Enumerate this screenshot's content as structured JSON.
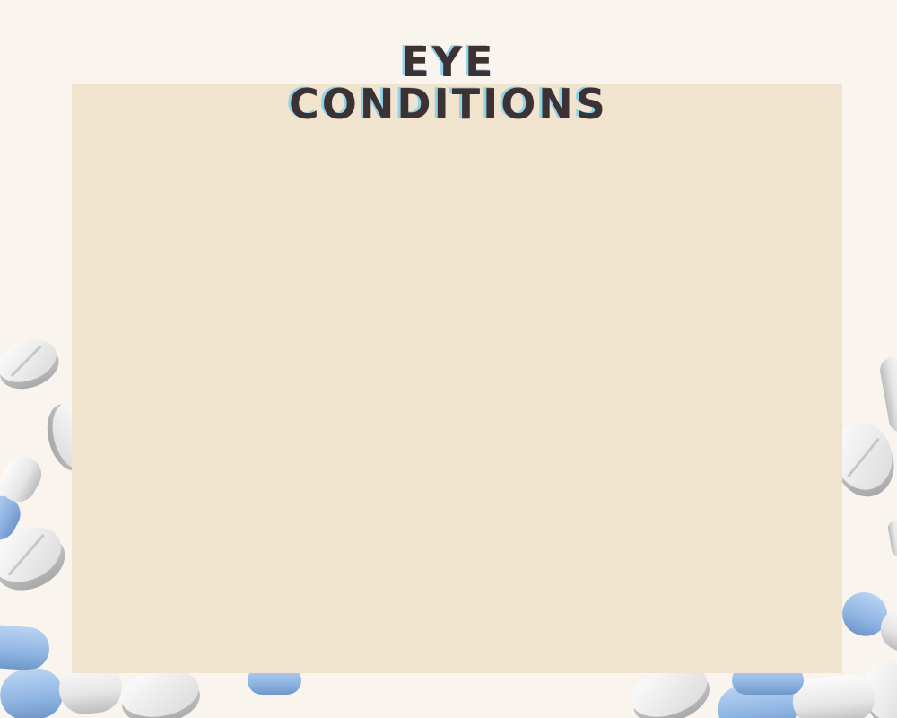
{
  "title": {
    "line1": "EYE",
    "line2": "CONDITIONS"
  },
  "decor": {
    "background_color": "#f9f5ee",
    "panel_color": "#f0e4cf",
    "title_color": "#3c3133",
    "title_shadow_color": "#8fd3ea",
    "pill_white": "#eeeeee",
    "pill_blue": "#8fb5e3",
    "icons": [
      "tablet-icon",
      "capsule-icon"
    ]
  }
}
